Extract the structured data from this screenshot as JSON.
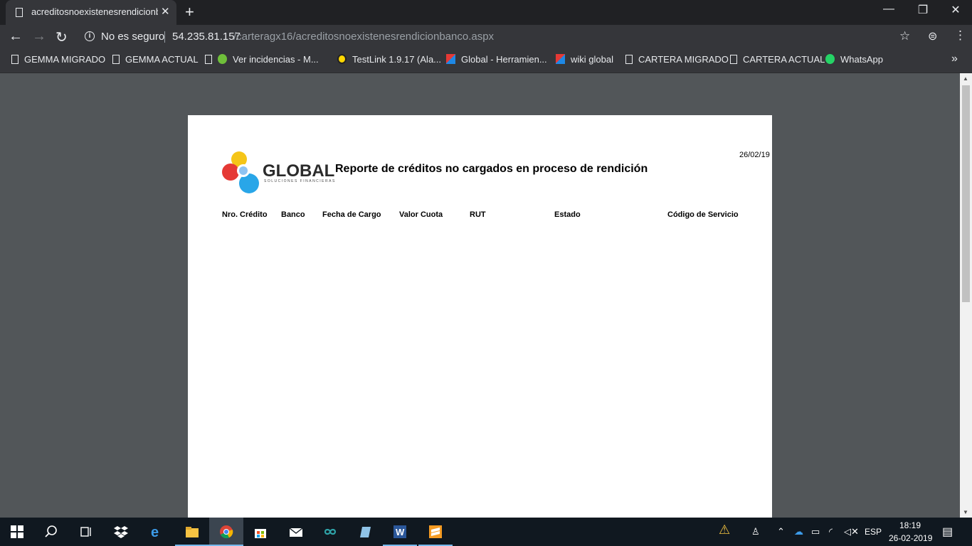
{
  "browser": {
    "tab_title": "acreditosnoexistenesrendicionbanco.aspx",
    "security_label": "No es seguro",
    "url_host": "54.235.81.157",
    "url_path": "/carteragx16/acreditosnoexistenesrendicionbanco.aspx",
    "bookmarks": [
      {
        "label": "GEMMA MIGRADO",
        "icon": "page-icon"
      },
      {
        "label": "GEMMA ACTUAL",
        "icon": "page-icon"
      },
      {
        "label": "Ver incidencias - M...",
        "icon": "frog-icon"
      },
      {
        "label": "TestLink 1.9.17 (Ala...",
        "icon": "testlink-icon"
      },
      {
        "label": "Global - Herramien...",
        "icon": "global-icon"
      },
      {
        "label": "wiki global",
        "icon": "global-icon"
      },
      {
        "label": "CARTERA MIGRADO",
        "icon": "page-icon"
      },
      {
        "label": "CARTERA ACTUAL",
        "icon": "page-icon"
      },
      {
        "label": "WhatsApp",
        "icon": "whatsapp-icon"
      }
    ]
  },
  "report": {
    "date": "26/02/19",
    "logo_text": "GLOBAL",
    "logo_subtitle": "SOLUCIONES FINANCIERAS",
    "title": "Reporte de créditos no cargados en proceso de rendición",
    "columns": [
      "Nro. Crédito",
      "Banco",
      "Fecha de Cargo",
      "Valor Cuota",
      "RUT",
      "Estado",
      "Código de Servicio"
    ]
  },
  "taskbar": {
    "language": "ESP",
    "time": "18:19",
    "date": "26-02-2019"
  },
  "colors": {
    "viewer_background": "#525659",
    "chrome_dark": "#35363a",
    "taskbar": "#101820"
  }
}
